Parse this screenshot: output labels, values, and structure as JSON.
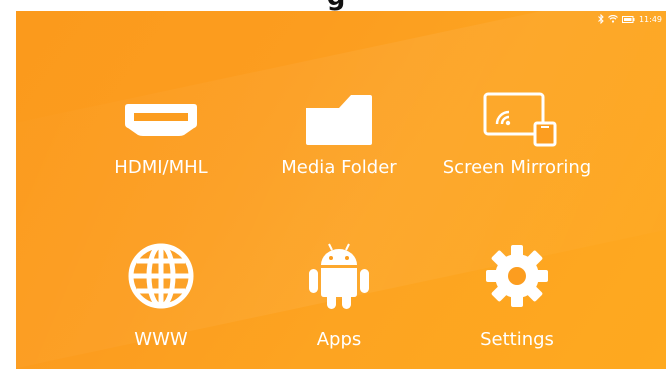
{
  "header": {
    "heading_fragment": "g"
  },
  "status_bar": {
    "icons": [
      "bluetooth-icon",
      "wifi-icon",
      "battery-icon"
    ],
    "time": "11:49"
  },
  "menu": {
    "items": [
      {
        "label": "HDMI/MHL",
        "icon": "hdmi-icon"
      },
      {
        "label": "Media Folder",
        "icon": "folder-icon"
      },
      {
        "label": "Screen Mirroring",
        "icon": "screen-mirroring-icon"
      },
      {
        "label": "WWW",
        "icon": "globe-icon"
      },
      {
        "label": "Apps",
        "icon": "android-icon"
      },
      {
        "label": "Settings",
        "icon": "gear-icon"
      }
    ]
  },
  "colors": {
    "background_orange": "#fc9d1f",
    "icon_color": "#ffffff"
  }
}
